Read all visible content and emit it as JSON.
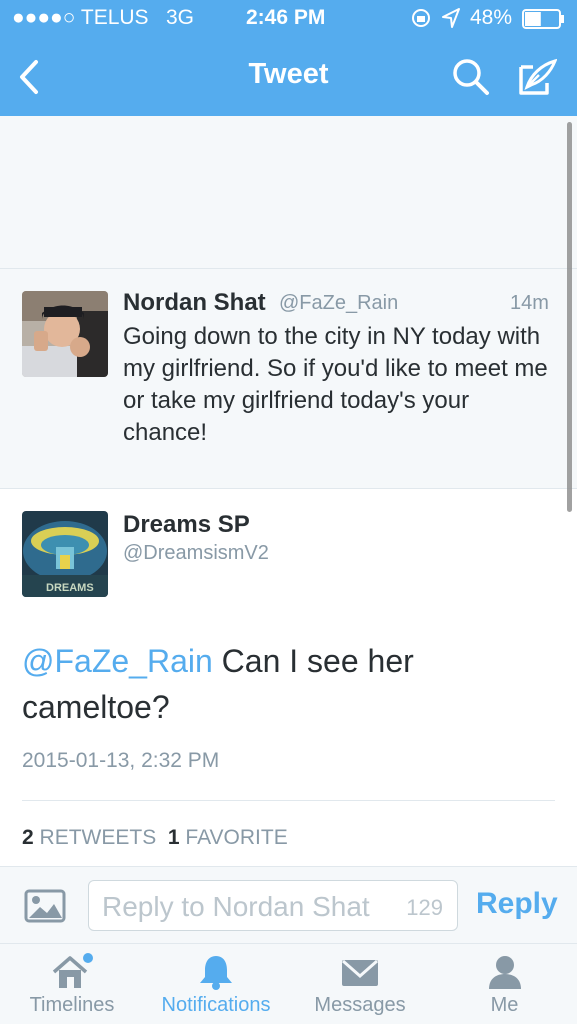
{
  "status_bar": {
    "carrier": "●●●●○ TELUS",
    "network": "3G",
    "time": "2:46 PM",
    "battery_percent": "48%",
    "battery_level": 0.48
  },
  "nav": {
    "title": "Tweet",
    "icons": [
      "back-chevron-icon",
      "search-icon",
      "compose-icon"
    ]
  },
  "context_tweet": {
    "name": "Nordan Shat",
    "handle": "@FaZe_Rain",
    "time": "14m",
    "text": "Going down to the city in NY today with my girlfriend. So if you'd like to meet me or take my girlfriend today's your chance!"
  },
  "main_tweet": {
    "name": "Dreams SP",
    "handle": "@DreamsismV2",
    "avatar_label": "DREAMS",
    "mention": "@FaZe_Rain",
    "text": " Can I see her cameltoe?",
    "date": "2015-01-13, 2:32 PM",
    "retweets_count": "2",
    "retweets_label": "RETWEETS",
    "favorites_count": "1",
    "favorites_label": "FAVORITE"
  },
  "reply_bar": {
    "placeholder": "Reply to Nordan Shat",
    "char_count": "129",
    "button": "Reply"
  },
  "tabs": [
    {
      "label": "Timelines",
      "icon": "home-icon",
      "active": false
    },
    {
      "label": "Notifications",
      "icon": "bell-icon",
      "active": true
    },
    {
      "label": "Messages",
      "icon": "envelope-icon",
      "active": false
    },
    {
      "label": "Me",
      "icon": "person-icon",
      "active": false
    }
  ],
  "colors": {
    "brand": "#55acee",
    "text": "#292f33",
    "muted": "#8899a6"
  }
}
